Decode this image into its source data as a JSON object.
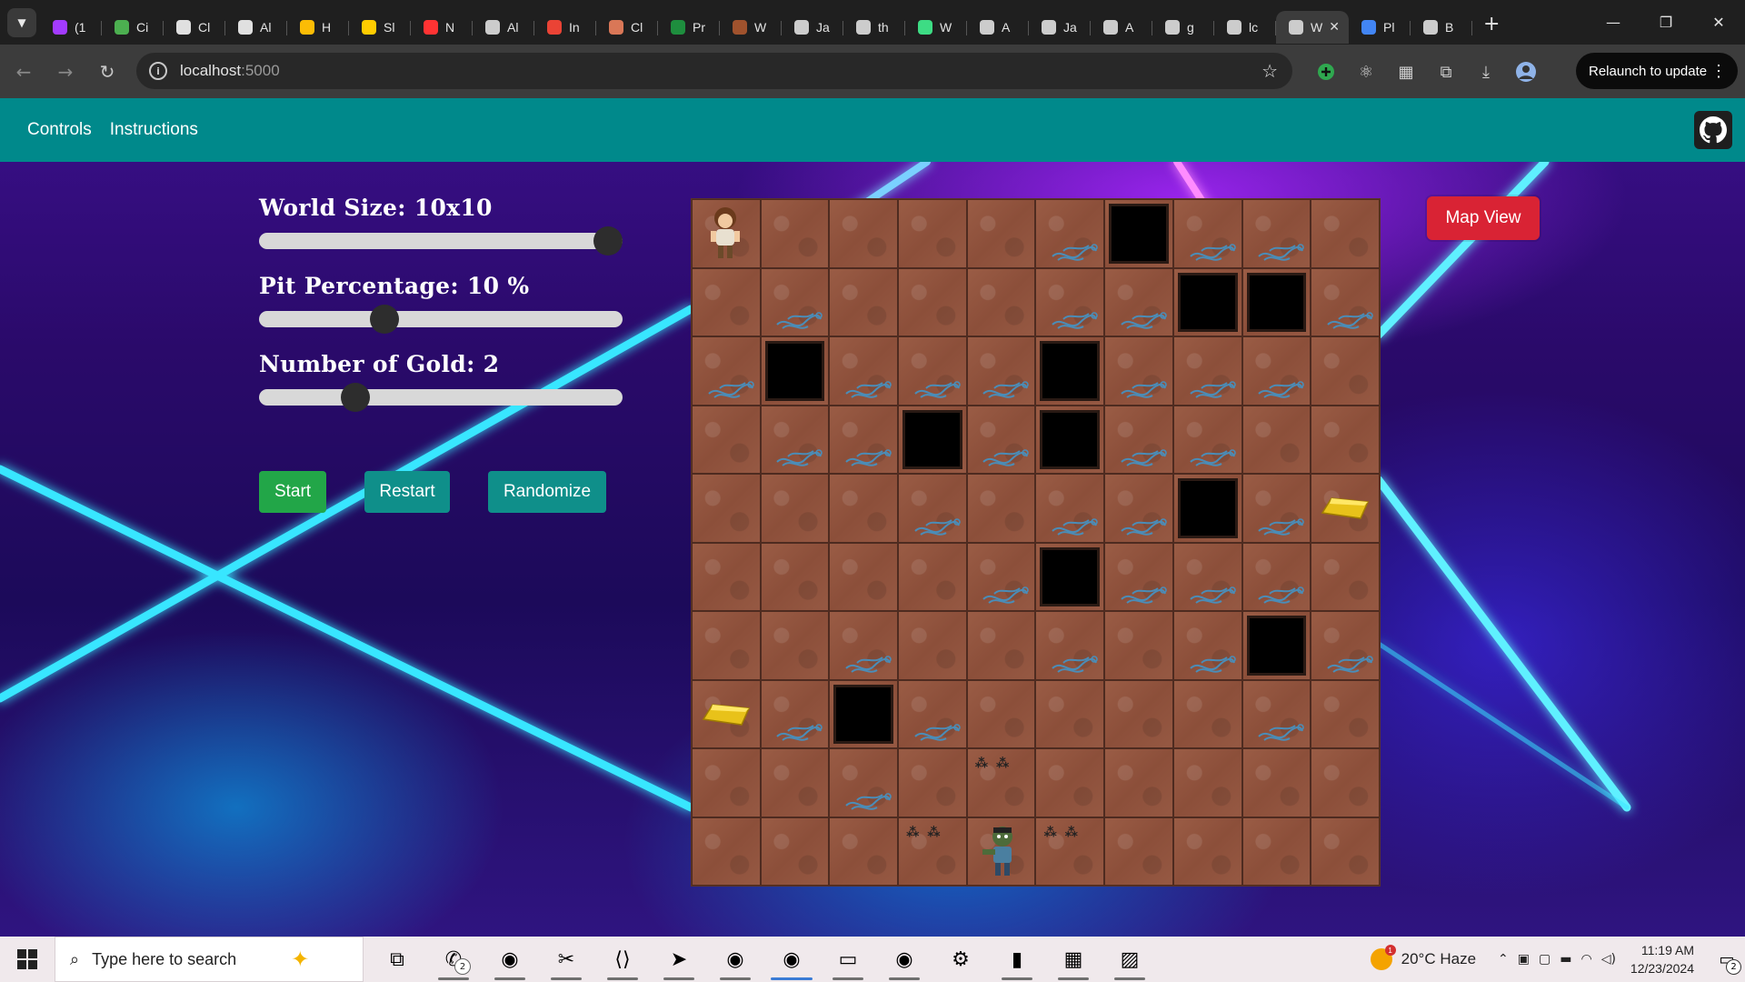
{
  "browser": {
    "tabs": [
      {
        "title": "(1",
        "icon": "messenger-icon",
        "color": "#a33bff"
      },
      {
        "title": "Ci",
        "icon": "codechef-icon",
        "color": "#4caf50"
      },
      {
        "title": "Cl",
        "icon": "chatgpt-icon",
        "color": "#e0e0e0"
      },
      {
        "title": "Al",
        "icon": "chatgpt-icon",
        "color": "#e0e0e0"
      },
      {
        "title": "H",
        "icon": "google-drive-icon",
        "color": "#fbbc05"
      },
      {
        "title": "Sl",
        "icon": "hugging-face-icon",
        "color": "#ffcc00"
      },
      {
        "title": "N",
        "icon": "infinity-icon",
        "color": "#ff3333"
      },
      {
        "title": "Al",
        "icon": "github-icon",
        "color": "#cccccc"
      },
      {
        "title": "In",
        "icon": "gmail-icon",
        "color": "#ea4335"
      },
      {
        "title": "Cl",
        "icon": "claude-icon",
        "color": "#d97757"
      },
      {
        "title": "Pr",
        "icon": "classroom-icon",
        "color": "#1e8e3e"
      },
      {
        "title": "W",
        "icon": "monkey-icon",
        "color": "#a0522d"
      },
      {
        "title": "Ja",
        "icon": "github-icon",
        "color": "#cccccc"
      },
      {
        "title": "th",
        "icon": "github-icon",
        "color": "#cccccc"
      },
      {
        "title": "W",
        "icon": "android-icon",
        "color": "#3ddc84"
      },
      {
        "title": "A",
        "icon": "github-icon",
        "color": "#cccccc"
      },
      {
        "title": "Ja",
        "icon": "github-icon",
        "color": "#cccccc"
      },
      {
        "title": "A",
        "icon": "github-icon",
        "color": "#cccccc"
      },
      {
        "title": "g",
        "icon": "globe-icon",
        "color": "#cccccc"
      },
      {
        "title": "lc",
        "icon": "globe-icon",
        "color": "#cccccc"
      },
      {
        "title": "W",
        "icon": "globe-icon",
        "color": "#cccccc",
        "active": true
      },
      {
        "title": "Pl",
        "icon": "google-icon",
        "color": "#4285f4"
      },
      {
        "title": "B",
        "icon": "globe-icon",
        "color": "#cccccc"
      }
    ],
    "url_host": "localhost",
    "url_port": ":5000",
    "relaunch_label": "Relaunch to update"
  },
  "app": {
    "nav": {
      "controls": "Controls",
      "instructions": "Instructions"
    },
    "sliders": [
      {
        "label": "World Size: 10x10",
        "value_fraction": 0.96
      },
      {
        "label": "Pit Percentage: 10 %",
        "value_fraction": 0.345
      },
      {
        "label": "Number of Gold: 2",
        "value_fraction": 0.265
      }
    ],
    "buttons": {
      "start": "Start",
      "restart": "Restart",
      "randomize": "Randomize"
    },
    "map_view": "Map View",
    "colors": {
      "teal": "#00898b",
      "start_green": "#22a648",
      "map_view_red": "#d92334"
    },
    "grid": [
      [
        "A",
        "",
        "",
        "",
        "",
        "B",
        "P",
        "B",
        "B",
        ""
      ],
      [
        "",
        "B",
        "",
        "",
        "",
        "B",
        "B",
        "P",
        "P",
        "B"
      ],
      [
        "B",
        "P",
        "B",
        "B",
        "B",
        "P",
        "B",
        "B",
        "B",
        ""
      ],
      [
        "",
        "B",
        "B",
        "P",
        "B",
        "P",
        "B",
        "B",
        "",
        ""
      ],
      [
        "",
        "",
        "",
        "B",
        "",
        "B",
        "B",
        "P",
        "B",
        "G"
      ],
      [
        "",
        "",
        "",
        "",
        "B",
        "P",
        "B",
        "B",
        "B",
        ""
      ],
      [
        "",
        "",
        "B",
        "",
        "",
        "B",
        "",
        "B",
        "P",
        "B"
      ],
      [
        "G",
        "B",
        "P",
        "B",
        "",
        "",
        "",
        "",
        "B",
        ""
      ],
      [
        "",
        "",
        "B",
        "",
        "S",
        "",
        "",
        "",
        "",
        ""
      ],
      [
        "",
        "",
        "",
        "S",
        "W",
        "S",
        "",
        "",
        "",
        ""
      ]
    ]
  },
  "taskbar": {
    "search_placeholder": "Type here to search",
    "weather": "20°C  Haze",
    "weather_badge": "1",
    "time": "11:19 AM",
    "date": "12/23/2024",
    "whatsapp_badge": "2",
    "notif_count": "2",
    "apps": [
      {
        "icon": "task-view-icon",
        "glyph": "⧉"
      },
      {
        "icon": "whatsapp-icon",
        "glyph": "✆"
      },
      {
        "icon": "chrome-icon",
        "glyph": "◉"
      },
      {
        "icon": "snipping-tool-icon",
        "glyph": "✂"
      },
      {
        "icon": "vscode-icon",
        "glyph": "⟨⟩"
      },
      {
        "icon": "telegram-icon",
        "glyph": "➤"
      },
      {
        "icon": "chrome-profile-icon",
        "glyph": "◉"
      },
      {
        "icon": "chrome-profile-icon",
        "glyph": "◉"
      },
      {
        "icon": "file-explorer-icon",
        "glyph": "▭"
      },
      {
        "icon": "chrome-profile-icon",
        "glyph": "◉"
      },
      {
        "icon": "settings-icon",
        "glyph": "⚙"
      },
      {
        "icon": "terminal-icon",
        "glyph": "▮"
      },
      {
        "icon": "winrar-icon",
        "glyph": "▦"
      },
      {
        "icon": "photos-icon",
        "glyph": "▨"
      }
    ]
  }
}
